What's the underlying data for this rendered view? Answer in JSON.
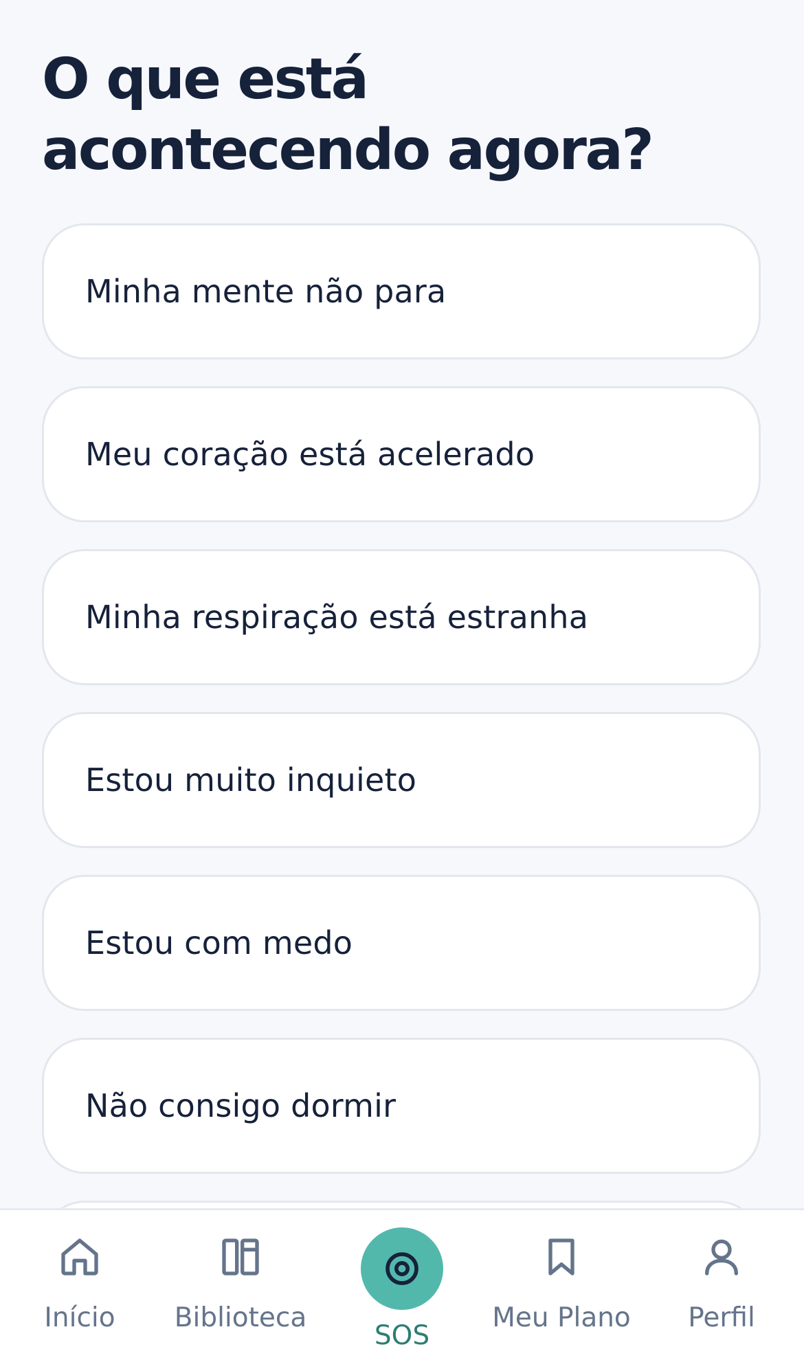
{
  "page": {
    "title": "O que está acontecendo agora?"
  },
  "options": [
    {
      "label": "Minha mente não para"
    },
    {
      "label": "Meu coração está acelerado"
    },
    {
      "label": "Minha respiração está estranha"
    },
    {
      "label": "Estou muito inquieto"
    },
    {
      "label": "Estou com medo"
    },
    {
      "label": "Não consigo dormir"
    }
  ],
  "tabbar": {
    "inicio": {
      "label": "Início",
      "icon": "home-icon"
    },
    "biblioteca": {
      "label": "Biblioteca",
      "icon": "library-icon"
    },
    "sos": {
      "label": "SOS",
      "icon": "target-icon"
    },
    "plano": {
      "label": "Meu Plano",
      "icon": "bookmark-icon"
    },
    "perfil": {
      "label": "Perfil",
      "icon": "user-icon"
    }
  },
  "colors": {
    "background": "#f6f8fb",
    "text": "#16213a",
    "accent": "#53b8ac",
    "accent_text": "#2d7d72",
    "muted": "#64748b"
  }
}
